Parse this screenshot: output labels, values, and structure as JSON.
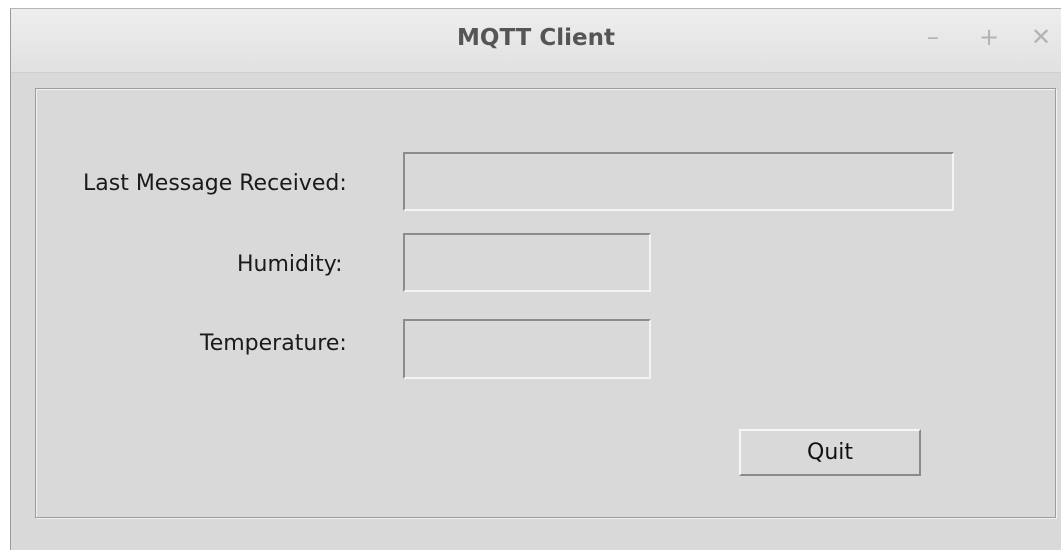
{
  "window": {
    "title": "MQTT Client",
    "controls": {
      "minimize": "–",
      "maximize": "+",
      "close": "✕"
    }
  },
  "form": {
    "last_message": {
      "label": "Last Message Received:",
      "value": ""
    },
    "humidity": {
      "label": "Humidity:",
      "value": ""
    },
    "temperature": {
      "label": "Temperature:",
      "value": ""
    },
    "quit_label": "Quit"
  },
  "icons": [
    "minimize-icon",
    "maximize-icon",
    "close-icon"
  ],
  "colors": {
    "window_bg": "#d9d9d9",
    "title_text": "#555555",
    "control_glyph": "#b3b3b3"
  }
}
